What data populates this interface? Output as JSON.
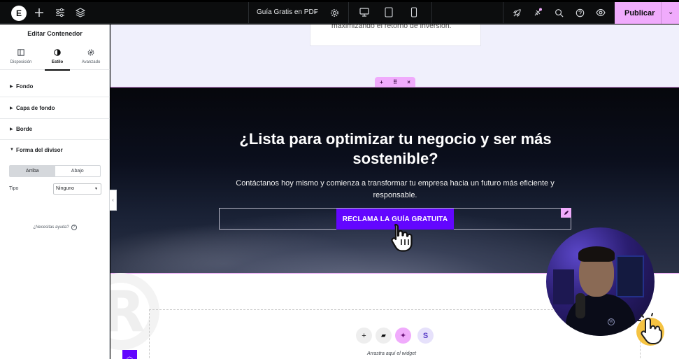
{
  "topbar": {
    "logo_text": "E",
    "add_icon": "plus-icon",
    "settings_icon": "sliders-icon",
    "structure_icon": "layers-icon",
    "document_title": "Guía Gratis en PDF",
    "document_chevron": "chevron-down-icon",
    "page_settings_icon": "gear-icon",
    "devices": [
      "desktop-icon",
      "tablet-icon",
      "mobile-icon"
    ],
    "right_icons": [
      "rocket-icon",
      "integrations-icon",
      "search-icon",
      "help-icon",
      "eye-icon"
    ],
    "publish_label": "Publicar",
    "publish_chevron": "chevron-down-icon",
    "accent_color": "#f0abfc"
  },
  "panel": {
    "title": "Editar Contenedor",
    "tabs": [
      {
        "label": "Disposición",
        "icon": "layout-icon",
        "active": false
      },
      {
        "label": "Estilo",
        "icon": "contrast-icon",
        "active": true
      },
      {
        "label": "Avanzado",
        "icon": "gear-icon",
        "active": false
      }
    ],
    "sections": [
      {
        "label": "Fondo",
        "expanded": false
      },
      {
        "label": "Capa de fondo",
        "expanded": false
      },
      {
        "label": "Borde",
        "expanded": false
      },
      {
        "label": "Forma del divisor",
        "expanded": true
      }
    ],
    "divider_toggle": {
      "options": [
        "Arriba",
        "Abajo"
      ],
      "selected": "Arriba"
    },
    "tipo": {
      "label": "Tipo",
      "value": "Ninguno"
    },
    "help_text": "¿Necesitas ayuda?",
    "collapse_icon": "chevron-left-icon"
  },
  "canvas": {
    "card_text": "maximizando el retorno de inversión.",
    "container_controls": [
      "+",
      "⠿",
      "×"
    ],
    "hero": {
      "title": "¿Lista para optimizar tu negocio y ser más sostenible?",
      "subtitle": "Contáctanos hoy mismo y comienza a transformar tu empresa hacia un futuro más eficiente y responsable.",
      "cta_label": "RECLAMA LA GUÍA GRATUITA",
      "cta_color": "#6306ff"
    },
    "dropzone": {
      "buttons": [
        {
          "icon": "plus-icon",
          "glyph": "+"
        },
        {
          "icon": "folder-icon",
          "glyph": "▰"
        },
        {
          "icon": "ai-sparkle-icon",
          "glyph": "✦"
        },
        {
          "icon": "s-logo-icon",
          "glyph": "S"
        }
      ],
      "hint": "Arrastra aquí el widget"
    },
    "scroll_top_icon": "chevron-up-icon"
  }
}
